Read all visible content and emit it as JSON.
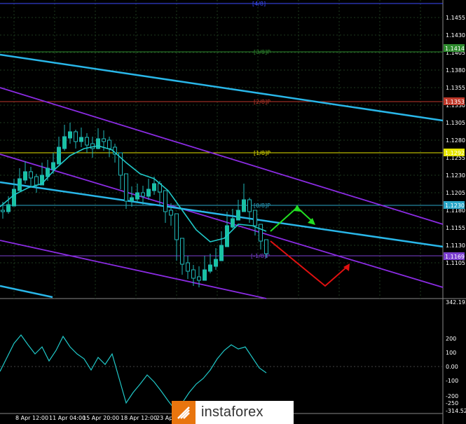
{
  "price_axis": {
    "labels": [
      "1.1455",
      "1.1430",
      "1.1405",
      "1.1380",
      "1.1355",
      "1.1330",
      "1.1305",
      "1.1280",
      "1.1255",
      "1.1230",
      "1.1205",
      "1.1180",
      "1.1155",
      "1.1130",
      "1.1105"
    ],
    "tags": [
      {
        "text": "1.1414",
        "color": "#2e8b2e"
      },
      {
        "text": "1.1353",
        "color": "#c0392b"
      },
      {
        "text": "1.1292",
        "color": "#e5e500"
      },
      {
        "text": "1.1230",
        "color": "#2aa6c8"
      },
      {
        "text": "1.1169",
        "color": "#7b3fd0"
      }
    ]
  },
  "murray_labels": [
    {
      "text": "[4/8]",
      "color": "#3b4bff"
    },
    {
      "text": "[3/8]P",
      "color": "#2e8b2e"
    },
    {
      "text": "[2/8]P",
      "color": "#c0392b"
    },
    {
      "text": "[1/8]P",
      "color": "#e5e500"
    },
    {
      "text": "[0/8]P",
      "color": "#2aa6c8"
    },
    {
      "text": "[-1/8]P",
      "color": "#7b3fd0"
    }
  ],
  "time_axis": [
    "8 Apr 12:00",
    "11 Apr 04:00",
    "15 Apr 20:00",
    "18 Apr 12:00",
    "23 Apr"
  ],
  "indicator_axis": [
    "342.1937",
    "200",
    "100",
    "0.00",
    "-100",
    "-200",
    "-250",
    "-314.522"
  ],
  "watermark": {
    "brand": "instaforex"
  },
  "colors": {
    "grid": "#1e3a1e",
    "channel": "#8a2be2",
    "trend": "#29b6e8",
    "ma": "#20c8c8",
    "up_arrow": "#22dd22",
    "down_arrow": "#e01010"
  }
}
